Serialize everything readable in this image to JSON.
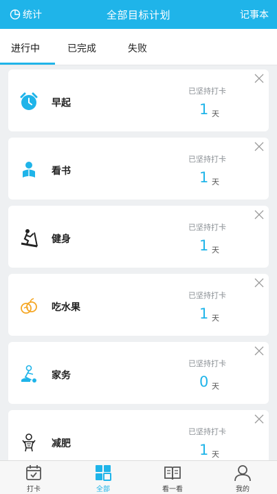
{
  "header": {
    "left_label": "统计",
    "title": "全部目标计划",
    "right_label": "记事本"
  },
  "tabs": [
    {
      "label": "进行中",
      "active": true
    },
    {
      "label": "已完成",
      "active": false
    },
    {
      "label": "失败",
      "active": false
    }
  ],
  "streak_label": "已坚持打卡",
  "unit": "天",
  "plans": [
    {
      "name": "早起",
      "days": "1",
      "icon": "alarm-clock-icon"
    },
    {
      "name": "看书",
      "days": "1",
      "icon": "reader-icon"
    },
    {
      "name": "健身",
      "days": "1",
      "icon": "treadmill-icon"
    },
    {
      "name": "吃水果",
      "days": "1",
      "icon": "fruit-icon"
    },
    {
      "name": "家务",
      "days": "0",
      "icon": "vacuum-icon"
    },
    {
      "name": "减肥",
      "days": "1",
      "icon": "slimming-icon"
    }
  ],
  "bottom_nav": [
    {
      "label": "打卡",
      "icon": "calendar-icon",
      "active": false
    },
    {
      "label": "全部",
      "icon": "grid-icon",
      "active": true
    },
    {
      "label": "看一看",
      "icon": "book-icon",
      "active": false
    },
    {
      "label": "我的",
      "icon": "profile-icon",
      "active": false
    }
  ],
  "colors": {
    "accent": "#1fb4e9",
    "fruit": "#f5a623",
    "dark_icon": "#222222"
  }
}
